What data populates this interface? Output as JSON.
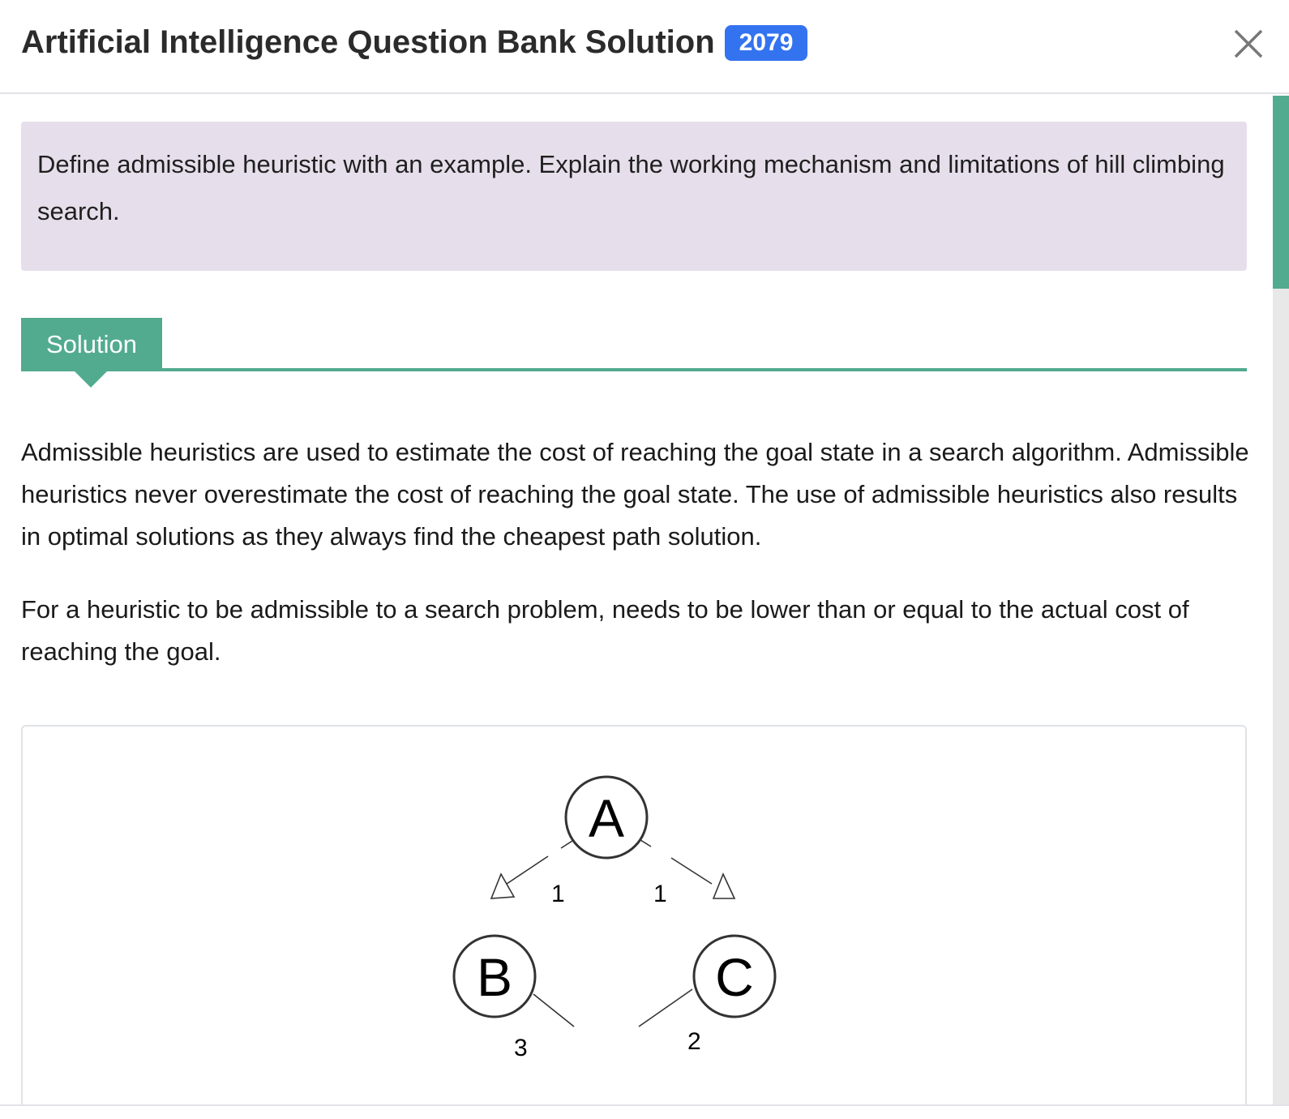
{
  "header": {
    "title": "Artificial Intelligence Question Bank Solution",
    "year_badge": "2079",
    "close_icon": "close-icon"
  },
  "question": {
    "text": "Define admissible heuristic with an example. Explain the working mechanism and limitations of hill climbing search."
  },
  "tabs": [
    {
      "label": "Solution",
      "active": true
    }
  ],
  "solution": {
    "paragraphs": [
      "Admissible heuristics are used to estimate the cost of reaching the goal state in a search algorithm. Admissible heuristics never overestimate the cost of reaching the goal state. The use of admissible heuristics also results in optimal solutions as they always find the cheapest path solution.",
      "For a heuristic to be admissible to a search problem, needs to be lower than or equal to the actual cost of reaching the goal."
    ],
    "diagram": {
      "nodes": [
        "A",
        "B",
        "C"
      ],
      "edges": [
        {
          "from": "A",
          "to": "B",
          "label": "1"
        },
        {
          "from": "A",
          "to": "C",
          "label": "1"
        },
        {
          "from": "B",
          "to": "",
          "label": "3"
        },
        {
          "from": "C",
          "to": "",
          "label": "2"
        }
      ]
    }
  },
  "colors": {
    "accent": "#52ab8f",
    "badge": "#3473f0",
    "question_bg": "#e6dfeb"
  }
}
